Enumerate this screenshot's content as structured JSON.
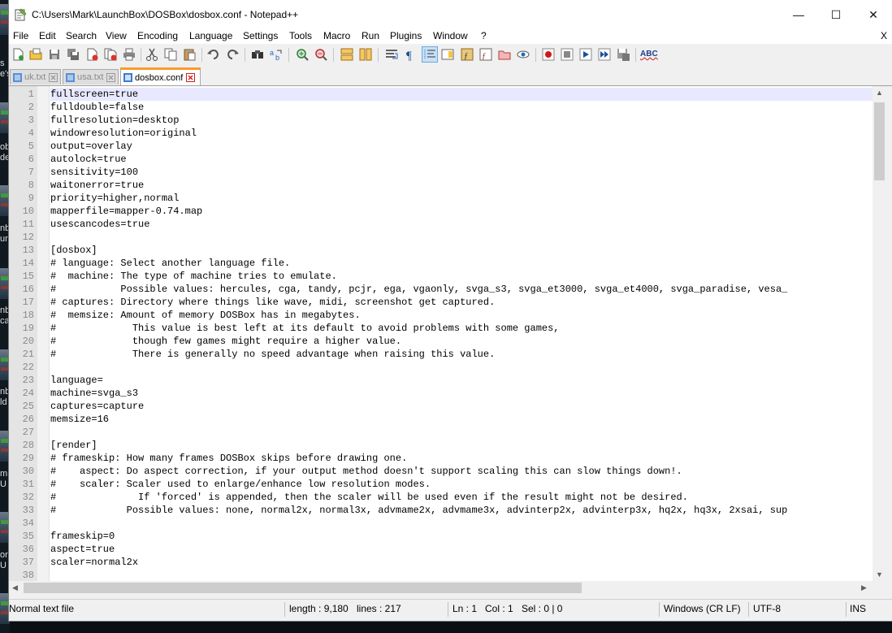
{
  "window": {
    "title": "C:\\Users\\Mark\\LaunchBox\\DOSBox\\dosbox.conf - Notepad++",
    "minimize_glyph": "—",
    "maximize_glyph": "☐",
    "close_glyph": "✕"
  },
  "desktop_fragments": [
    "s",
    "e's",
    "ob",
    "de",
    "nb",
    "ur",
    "nb",
    "ca",
    "nb",
    "ld",
    "m",
    "U",
    "or",
    "U"
  ],
  "menu": {
    "items": [
      "File",
      "Edit",
      "Search",
      "View",
      "Encoding",
      "Language",
      "Settings",
      "Tools",
      "Macro",
      "Run",
      "Plugins",
      "Window",
      "?"
    ],
    "close_label": "X"
  },
  "toolbar": {
    "icons": [
      "new-file-icon",
      "open-file-icon",
      "save-icon",
      "save-all-icon",
      "close-icon",
      "close-all-icon",
      "print-icon",
      "cut-icon",
      "copy-icon",
      "paste-icon",
      "undo-icon",
      "redo-icon",
      "find-icon",
      "replace-icon",
      "zoom-in-icon",
      "zoom-out-icon",
      "sync-vertical-icon",
      "sync-horizontal-icon",
      "word-wrap-icon",
      "show-all-chars-icon",
      "indent-guide-icon",
      "doc-map-icon",
      "function-list-icon",
      "folder-workspace-icon",
      "monitoring-icon",
      "macro-record-icon",
      "macro-stop-icon",
      "macro-play-icon",
      "macro-run-multiple-icon",
      "macro-save-icon",
      "spell-check-icon"
    ],
    "spell_label": "ABC",
    "active_icon": "indent-guide-icon"
  },
  "tabs": [
    {
      "label": "uk.txt",
      "active": false
    },
    {
      "label": "usa.txt",
      "active": false
    },
    {
      "label": "dosbox.conf",
      "active": true
    }
  ],
  "editor": {
    "current_line": 1,
    "lines": [
      "fullscreen=true",
      "fulldouble=false",
      "fullresolution=desktop",
      "windowresolution=original",
      "output=overlay",
      "autolock=true",
      "sensitivity=100",
      "waitonerror=true",
      "priority=higher,normal",
      "mapperfile=mapper-0.74.map",
      "usescancodes=true",
      "",
      "[dosbox]",
      "# language: Select another language file.",
      "#  machine: The type of machine tries to emulate.",
      "#           Possible values: hercules, cga, tandy, pcjr, ega, vgaonly, svga_s3, svga_et3000, svga_et4000, svga_paradise, vesa_",
      "# captures: Directory where things like wave, midi, screenshot get captured.",
      "#  memsize: Amount of memory DOSBox has in megabytes.",
      "#             This value is best left at its default to avoid problems with some games,",
      "#             though few games might require a higher value.",
      "#             There is generally no speed advantage when raising this value.",
      "",
      "language=",
      "machine=svga_s3",
      "captures=capture",
      "memsize=16",
      "",
      "[render]",
      "# frameskip: How many frames DOSBox skips before drawing one.",
      "#    aspect: Do aspect correction, if your output method doesn't support scaling this can slow things down!.",
      "#    scaler: Scaler used to enlarge/enhance low resolution modes.",
      "#              If 'forced' is appended, then the scaler will be used even if the result might not be desired.",
      "#            Possible values: none, normal2x, normal3x, advmame2x, advmame3x, advinterp2x, advinterp3x, hq2x, hq3x, 2xsai, sup",
      "",
      "frameskip=0",
      "aspect=true",
      "scaler=normal2x",
      ""
    ]
  },
  "statusbar": {
    "type": "Normal text file",
    "length": "length : 9,180",
    "lines": "lines : 217",
    "ln": "Ln : 1",
    "col": "Col : 1",
    "sel": "Sel : 0 | 0",
    "eol": "Windows (CR LF)",
    "encoding": "UTF-8",
    "mode": "INS"
  },
  "colors": {
    "accent_tab": "#fa9b2b",
    "current_line": "#e8e8ff",
    "gutter": "#e4e4e4"
  }
}
